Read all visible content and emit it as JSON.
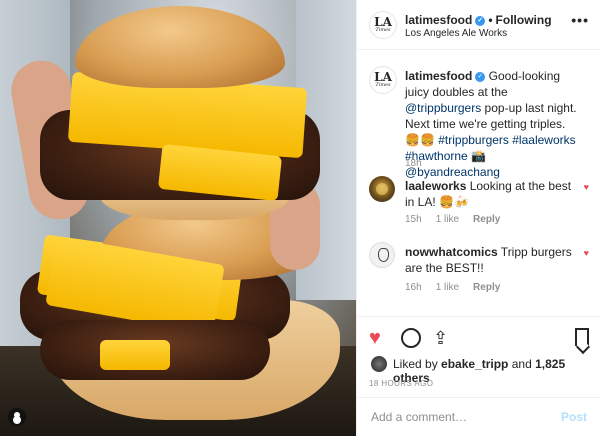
{
  "header": {
    "username": "latimesfood",
    "separator": "•",
    "follow_label": "Following",
    "location": "Los Angeles Ale Works",
    "more": "•••",
    "logo_line1": "LA",
    "logo_line2": "Times"
  },
  "caption": {
    "username": "latimesfood",
    "text_before": " Good-looking juicy doubles at the ",
    "mention1": "@trippburgers",
    "text_middle": " pop-up last night. Next time we're getting triples. 🍔🍔 ",
    "hashtags": "#trippburgers #laaleworks #hawthorne",
    "emoji_camera": " 📸 ",
    "mention2": "@byandreachang",
    "time": "18h"
  },
  "comments": [
    {
      "username": "laaleworks",
      "text": " Looking at the best in LA! 🍔🍻",
      "time": "15h",
      "likes": "1 like",
      "reply": "Reply"
    },
    {
      "username": "nowwhatcomics",
      "text": " Tripp burgers are the BEST!!",
      "time": "16h",
      "likes": "1 like",
      "reply": "Reply"
    }
  ],
  "actions": {
    "liked_by_prefix": "Liked by ",
    "liked_by_user": "ebake_tripp",
    "liked_by_and": " and ",
    "liked_by_count": "1,825 others",
    "timestamp": "18 HOURS AGO",
    "comment_placeholder": "Add a comment…",
    "post_label": "Post"
  },
  "colors": {
    "accent_link": "#003569",
    "heart": "#ed4956",
    "post_disabled": "#b2dffc",
    "verified": "#3897f0"
  },
  "icons": [
    "verified-badge-icon",
    "more-options-icon",
    "heart-icon",
    "comment-icon",
    "share-icon",
    "bookmark-icon",
    "small-heart-icon"
  ]
}
